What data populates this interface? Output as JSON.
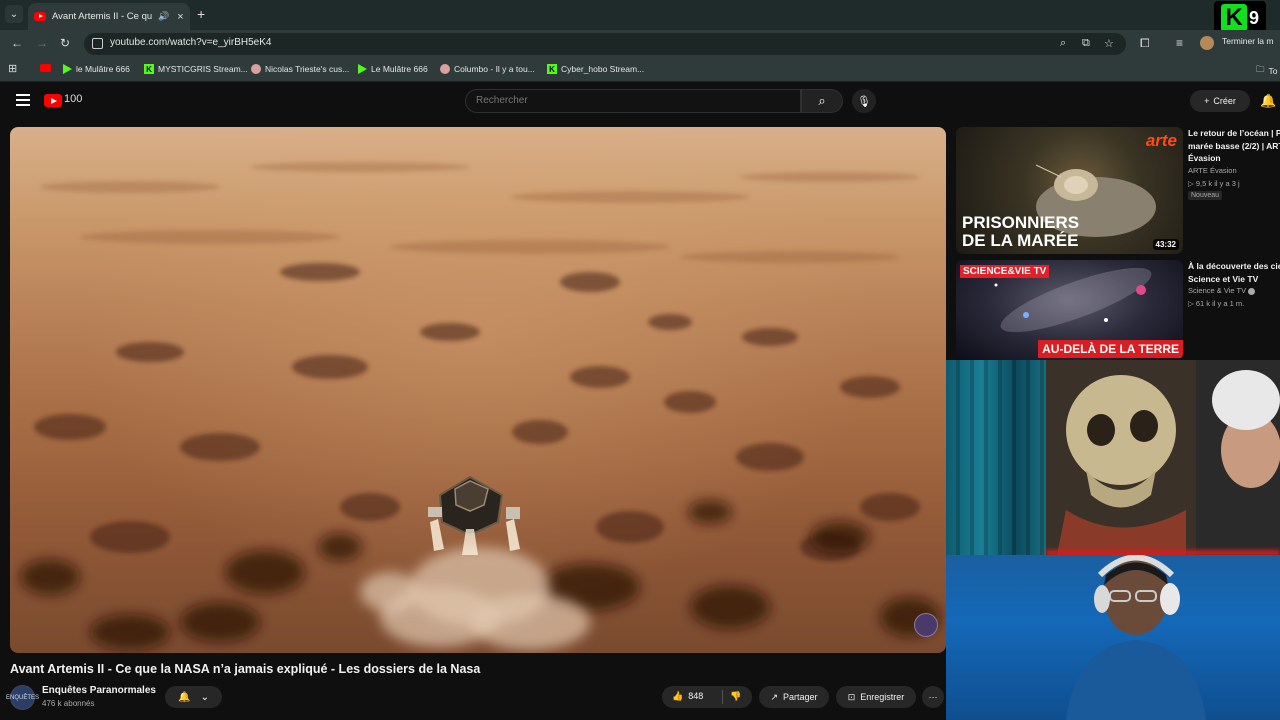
{
  "browser": {
    "tab": {
      "title": "Avant Artemis II - Ce que la",
      "audio_icon": "speaker-icon",
      "close_glyph": "×"
    },
    "new_tab_glyph": "+",
    "url": "youtube.com/watch?v=e_yirBH5eK4",
    "profile_action_label": "Terminer la m",
    "bookmarks": [
      {
        "label": "le Mulâtre 666",
        "icon": "kick-play-icon"
      },
      {
        "label": "MYSTICGRIS Stream...",
        "icon": "kick-k-icon"
      },
      {
        "label": "Nicolas Trieste's cus...",
        "icon": "twitch-emote-icon"
      },
      {
        "label": "Le Mulâtre 666",
        "icon": "kick-play-icon"
      },
      {
        "label": "Columbo - Il y a tou...",
        "icon": "bookmark-circle-icon"
      },
      {
        "label": "Cyber_hobo Stream...",
        "icon": "kick-k-icon"
      }
    ],
    "bookmarks_overflow_label": "To"
  },
  "overlay": {
    "k9_letter": "K",
    "k9_number": "9"
  },
  "youtube": {
    "search_placeholder": "Rechercher",
    "create_label": "Créer",
    "video": {
      "title": "Avant Artemis II - Ce que la NASA n’a jamais expliqué - Les dossiers de la Nasa",
      "channel_name": "Enquêtes Paranormales",
      "subscribers": "476 k abonnés",
      "likes": "848",
      "share_label": "Partager",
      "save_label": "Enregistrer",
      "channel_avatar_text": "ENQUÊTES"
    },
    "related": [
      {
        "title": "Le retour de l’océan | Pi\nmarée basse (2/2) | ART\nÉvasion",
        "channel": "ARTE Évasion",
        "meta": "▷ 9,5 k  il y a 3 j",
        "badge": "Nouveau",
        "thumb_logo": "arte",
        "thumb_text": "PRISONNIERS\nDE LA MARÉE",
        "duration": "43:32"
      },
      {
        "title": "À la découverte des cie\nScience et Vie TV",
        "channel": "Science & Vie TV",
        "meta": "▷ 61 k  il y a 1 m.",
        "thumb_logo": "SCIENCE&VIE TV",
        "thumb_text": "AU-DELÀ DE LA TERRE"
      }
    ]
  }
}
